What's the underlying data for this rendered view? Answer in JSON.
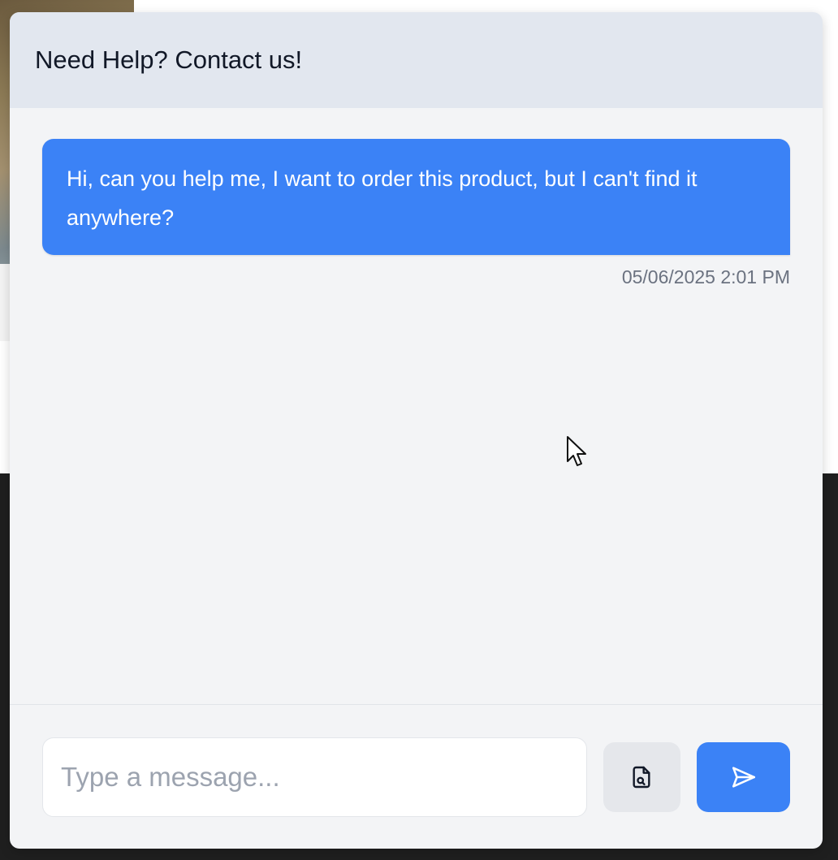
{
  "header": {
    "title": "Need Help? Contact us!"
  },
  "messages": [
    {
      "text": "Hi, can you help me, I want to order this product, but I can't find it anywhere?",
      "timestamp": "05/06/2025 2:01 PM",
      "sender": "user"
    }
  ],
  "composer": {
    "placeholder": "Type a message...",
    "value": "",
    "attach_icon": "file-search-icon",
    "send_icon": "send-icon"
  },
  "colors": {
    "accent": "#3b82f6",
    "header_bg": "#e2e7ef",
    "panel_bg": "#f3f4f6",
    "timestamp": "#6b7280"
  }
}
